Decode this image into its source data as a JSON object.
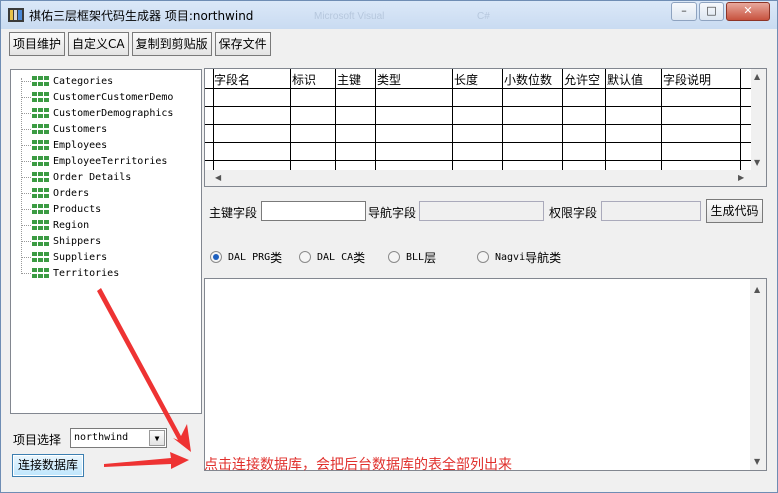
{
  "window": {
    "title": "祺佑三层框架代码生成器 项目:northwind",
    "ghost_text": [
      "Microsoft Visual",
      "C#"
    ],
    "controls": [
      "–",
      "□",
      "✕"
    ]
  },
  "toolbar": {
    "project_maintain": "项目维护",
    "custom_ca": "自定义CA",
    "copy_clipboard": "复制到剪贴版",
    "save_file": "保存文件"
  },
  "tree": {
    "items": [
      "Categories",
      "CustomerCustomerDemo",
      "CustomerDemographics",
      "Customers",
      "Employees",
      "EmployeeTerritories",
      "Order Details",
      "Orders",
      "Products",
      "Region",
      "Shippers",
      "Suppliers",
      "Territories"
    ]
  },
  "project": {
    "label": "项目选择",
    "selected": "northwind",
    "connect_button": "连接数据库"
  },
  "grid": {
    "columns": [
      "字段名",
      "标识",
      "主键",
      "类型",
      "长度",
      "小数位数",
      "允许空",
      "默认值",
      "字段说明"
    ]
  },
  "fields": {
    "primary_key_label": "主键字段",
    "primary_key_value": "",
    "nav_field_label": "导航字段",
    "nav_field_value": "",
    "permission_field_label": "权限字段",
    "permission_field_value": "",
    "generate_button": "生成代码"
  },
  "radios": [
    {
      "prefix": "DAL PRG",
      "suffix": "类",
      "checked": true
    },
    {
      "prefix": "DAL CA",
      "suffix": "类",
      "checked": false
    },
    {
      "prefix": "BLL",
      "suffix": "层",
      "checked": false
    },
    {
      "prefix": "Nagvi",
      "suffix": "导航类",
      "checked": false
    }
  ],
  "annotation": {
    "text": "点击连接数据库，会把后台数据库的表全部列出来",
    "color": "#e0302c"
  },
  "colors": {
    "tree_icon": "#3b9b43",
    "title_bar": "#dbe8f8"
  }
}
